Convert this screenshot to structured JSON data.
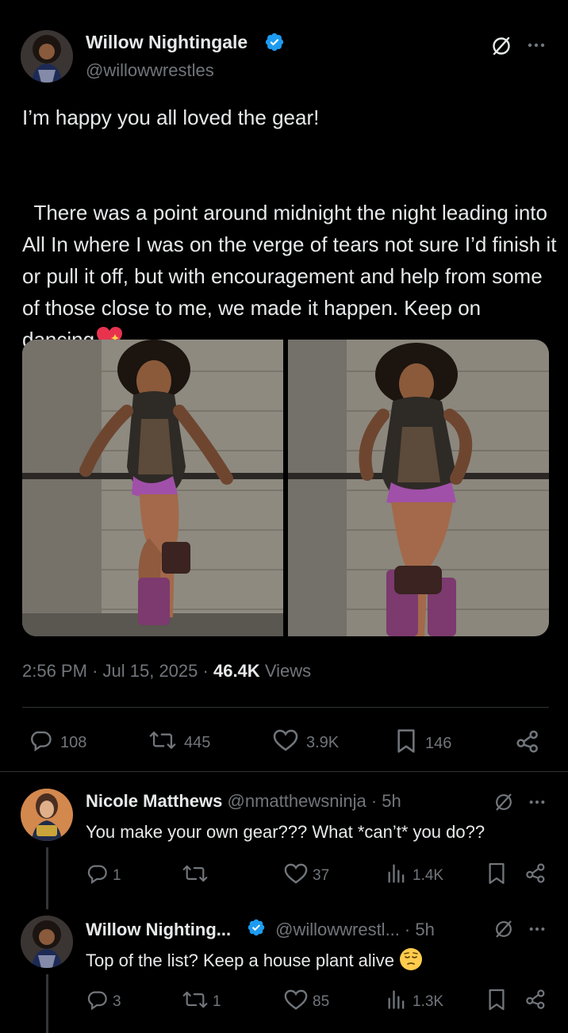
{
  "tweet": {
    "author_name": "Willow Nightingale",
    "author_handle": "@willowwrestles",
    "paragraph1": "I’m happy you all loved the gear!",
    "paragraph2": "There was a point around midnight the night leading into All In where I was on the verge of tears not sure I’d finish it or pull it off, but with encouragement and help from some of those close to me, we made it happen. Keep on dancing",
    "emoji": "sparkling-heart-emoji",
    "time": "2:56 PM",
    "dot": "·",
    "date": "Jul 15, 2025",
    "views_count": "46.4K",
    "views_label": "Views",
    "stats": {
      "replies": "108",
      "retweets": "445",
      "likes": "3.9K",
      "bookmarks": "146"
    }
  },
  "replies": [
    {
      "author_name": "Nicole Matthews",
      "author_handle": "@nmatthewsninja",
      "time": "· 5h",
      "text": "You make your own gear??? What *can’t* you do??",
      "stats": {
        "replies": "1",
        "retweets": "",
        "likes": "37",
        "views": "1.4K"
      }
    },
    {
      "author_name": "Willow Nighting...",
      "author_handle": "@willowwrestl...",
      "time": "· 5h",
      "text": "Top of the list? Keep a house plant alive",
      "emoji": "pensive-face-emoji",
      "stats": {
        "replies": "3",
        "retweets": "1",
        "likes": "85",
        "views": "1.3K"
      }
    }
  ],
  "icons": {
    "grok": "grok-icon",
    "more": "more-icon",
    "reply": "reply-icon",
    "retweet": "retweet-icon",
    "like": "like-icon",
    "bookmark": "bookmark-icon",
    "share": "share-icon",
    "views": "views-icon",
    "verified": "verified-badge-icon"
  },
  "colors": {
    "background": "#000000",
    "text": "#e7e9ea",
    "muted": "#71767b",
    "verified": "#1d9bf0",
    "divider": "#2f3336"
  }
}
